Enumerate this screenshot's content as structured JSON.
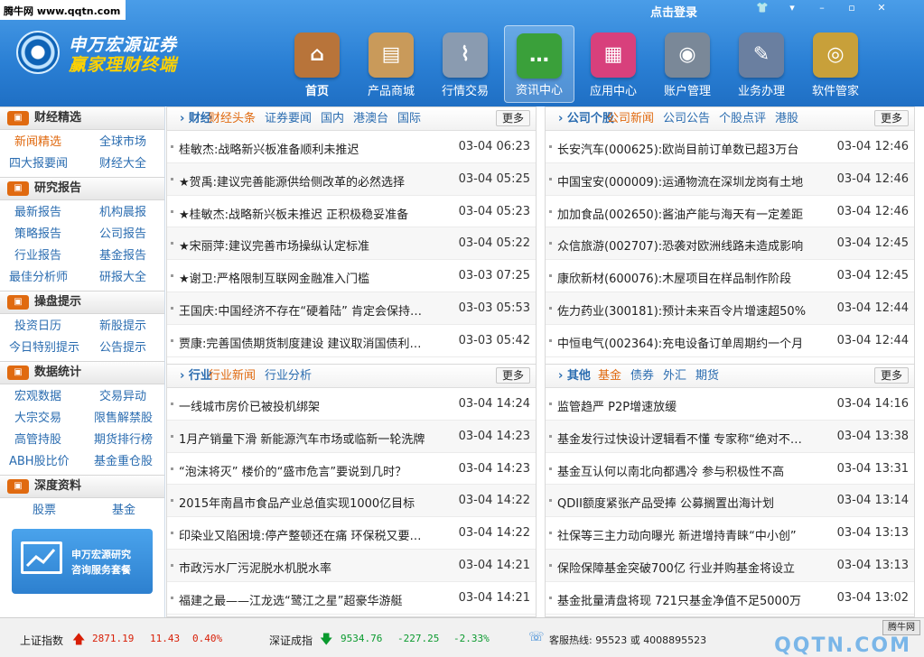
{
  "watermark": "腾牛网 www.qqtn.com",
  "header": {
    "login": "点击登录",
    "logo_line1": "申万宏源证券",
    "logo_line2": "赢家理财终端"
  },
  "window_controls": [
    "shirt-icon",
    "menu-down-icon",
    "minimize-icon",
    "restore-icon",
    "close-icon"
  ],
  "nav": [
    {
      "label": "首页",
      "icon": "home-icon",
      "color": "#b8743a",
      "glyph": "⌂"
    },
    {
      "label": "产品商城",
      "icon": "shopping-bag-icon",
      "color": "#c99a5a",
      "glyph": "▤"
    },
    {
      "label": "行情交易",
      "icon": "market-chart-icon",
      "color": "#8a9bb0",
      "glyph": "⌇"
    },
    {
      "label": "资讯中心",
      "icon": "chat-bubbles-icon",
      "color": "#3aa03a",
      "glyph": "…"
    },
    {
      "label": "应用中心",
      "icon": "app-grid-icon",
      "color": "#d8407c",
      "glyph": "▦"
    },
    {
      "label": "账户管理",
      "icon": "account-disc-icon",
      "color": "#7a8898",
      "glyph": "◉"
    },
    {
      "label": "业务办理",
      "icon": "notepad-icon",
      "color": "#6a7fa0",
      "glyph": "✎"
    },
    {
      "label": "软件管家",
      "icon": "cd-icon",
      "color": "#c8a03a",
      "glyph": "◎"
    }
  ],
  "nav_active": 3,
  "sidebar": [
    {
      "title": "财经精选",
      "rows": [
        [
          "新闻精选",
          "全球市场"
        ],
        [
          "四大报要闻",
          "财经大全"
        ]
      ],
      "hot": "新闻精选"
    },
    {
      "title": "研究报告",
      "rows": [
        [
          "最新报告",
          "机构晨报"
        ],
        [
          "策略报告",
          "公司报告"
        ],
        [
          "行业报告",
          "基金报告"
        ],
        [
          "最佳分析师",
          "研报大全"
        ]
      ]
    },
    {
      "title": "操盘提示",
      "rows": [
        [
          "投资日历",
          "新股提示"
        ],
        [
          "今日特别提示",
          "公告提示"
        ]
      ]
    },
    {
      "title": "数据统计",
      "rows": [
        [
          "宏观数据",
          "交易异动"
        ],
        [
          "大宗交易",
          "限售解禁股"
        ],
        [
          "高管持股",
          "期货排行榜"
        ],
        [
          "ABH股比价",
          "基金重仓股"
        ]
      ]
    },
    {
      "title": "深度资料",
      "rows": [
        [
          "股票",
          "基金"
        ]
      ]
    }
  ],
  "banner": {
    "line1": "申万宏源研究",
    "line2": "咨询服务套餐"
  },
  "panels": [
    {
      "title": "财经",
      "tabs": [
        "财经头条",
        "证券要闻",
        "国内",
        "港澳台",
        "国际"
      ],
      "active": 0,
      "more": "更多",
      "items": [
        [
          "桂敏杰:战略新兴板准备顺利未推迟",
          "03-04 06:23"
        ],
        [
          "★贺禹:建议完善能源供给侧改革的必然选择",
          "03-04 05:25"
        ],
        [
          "★桂敏杰:战略新兴板未推迟 正积极稳妥准备",
          "03-04 05:23"
        ],
        [
          "★宋丽萍:建议完善市场操纵认定标准",
          "03-04 05:22"
        ],
        [
          "★谢卫:严格限制互联网金融准入门槛",
          "03-03 07:25"
        ],
        [
          "王国庆:中国经济不存在“硬着陆” 肯定会保持中...",
          "03-03 05:53"
        ],
        [
          "贾康:完善国债期货制度建设 建议取消国债利息...",
          "03-03 05:42"
        ]
      ]
    },
    {
      "title": "公司个股",
      "tabs": [
        "公司新闻",
        "公司公告",
        "个股点评",
        "港股"
      ],
      "active": 0,
      "more": "更多",
      "items": [
        [
          "长安汽车(000625):欧尚目前订单数已超3万台",
          "03-04 12:46"
        ],
        [
          "中国宝安(000009):运通物流在深圳龙岗有土地",
          "03-04 12:46"
        ],
        [
          "加加食品(002650):酱油产能与海天有一定差距",
          "03-04 12:46"
        ],
        [
          "众信旅游(002707):恐袭对欧洲线路未造成影响",
          "03-04 12:45"
        ],
        [
          "康欣新材(600076):木屋项目在样品制作阶段",
          "03-04 12:45"
        ],
        [
          "佐力药业(300181):预计未来百令片增速超50%",
          "03-04 12:44"
        ],
        [
          "中恒电气(002364):充电设备订单周期约一个月",
          "03-04 12:44"
        ]
      ]
    },
    {
      "title": "行业",
      "tabs": [
        "行业新闻",
        "行业分析"
      ],
      "active": 0,
      "more": "更多",
      "items": [
        [
          "一线城市房价已被投机绑架",
          "03-04 14:24"
        ],
        [
          "1月产销量下滑 新能源汽车市场或临新一轮洗牌",
          "03-04 14:23"
        ],
        [
          "“泡沫将灭” 楼价的“盛市危言”要说到几时？",
          "03-04 14:23"
        ],
        [
          "2015年南昌市食品产业总值实现1000亿目标",
          "03-04 14:22"
        ],
        [
          "印染业又陷困境:停产整顿还在痛 环保税又要来了",
          "03-04 14:22"
        ],
        [
          "市政污水厂污泥脱水机脱水率",
          "03-04 14:21"
        ],
        [
          "福建之最——江龙选“鹭江之星”超豪华游艇",
          "03-04 14:21"
        ]
      ]
    },
    {
      "title": "其他",
      "tabs": [
        "基金",
        "债券",
        "外汇",
        "期货"
      ],
      "active": 0,
      "more": "更多",
      "items": [
        [
          "监管趋严 P2P增速放缓",
          "03-04 14:16"
        ],
        [
          "基金发行过快设计逻辑看不懂 专家称“绝对不敢...",
          "03-04 13:38"
        ],
        [
          "基金互认何以南北向都遇冷 参与积极性不高",
          "03-04 13:31"
        ],
        [
          "QDII额度紧张产品受捧 公募搁置出海计划",
          "03-04 13:14"
        ],
        [
          "社保等三主力动向曝光 新进增持青睐“中小创”",
          "03-04 13:13"
        ],
        [
          "保险保障基金突破700亿 行业并购基金将设立",
          "03-04 13:13"
        ],
        [
          "基金批量清盘将现 721只基金净值不足5000万",
          "03-04 13:02"
        ]
      ]
    }
  ],
  "status": {
    "sh_label": "上证指数",
    "sh_value": "2871.19",
    "sh_change": "11.43",
    "sh_pct": "0.40%",
    "sz_label": "深证成指",
    "sz_value": "9534.76",
    "sz_change": "-227.25",
    "sz_pct": "-2.33%",
    "hotline": "客服热线: 95523 或 4008895523",
    "brand_small": "腾牛网",
    "brand_big": "QQTN.COM"
  }
}
